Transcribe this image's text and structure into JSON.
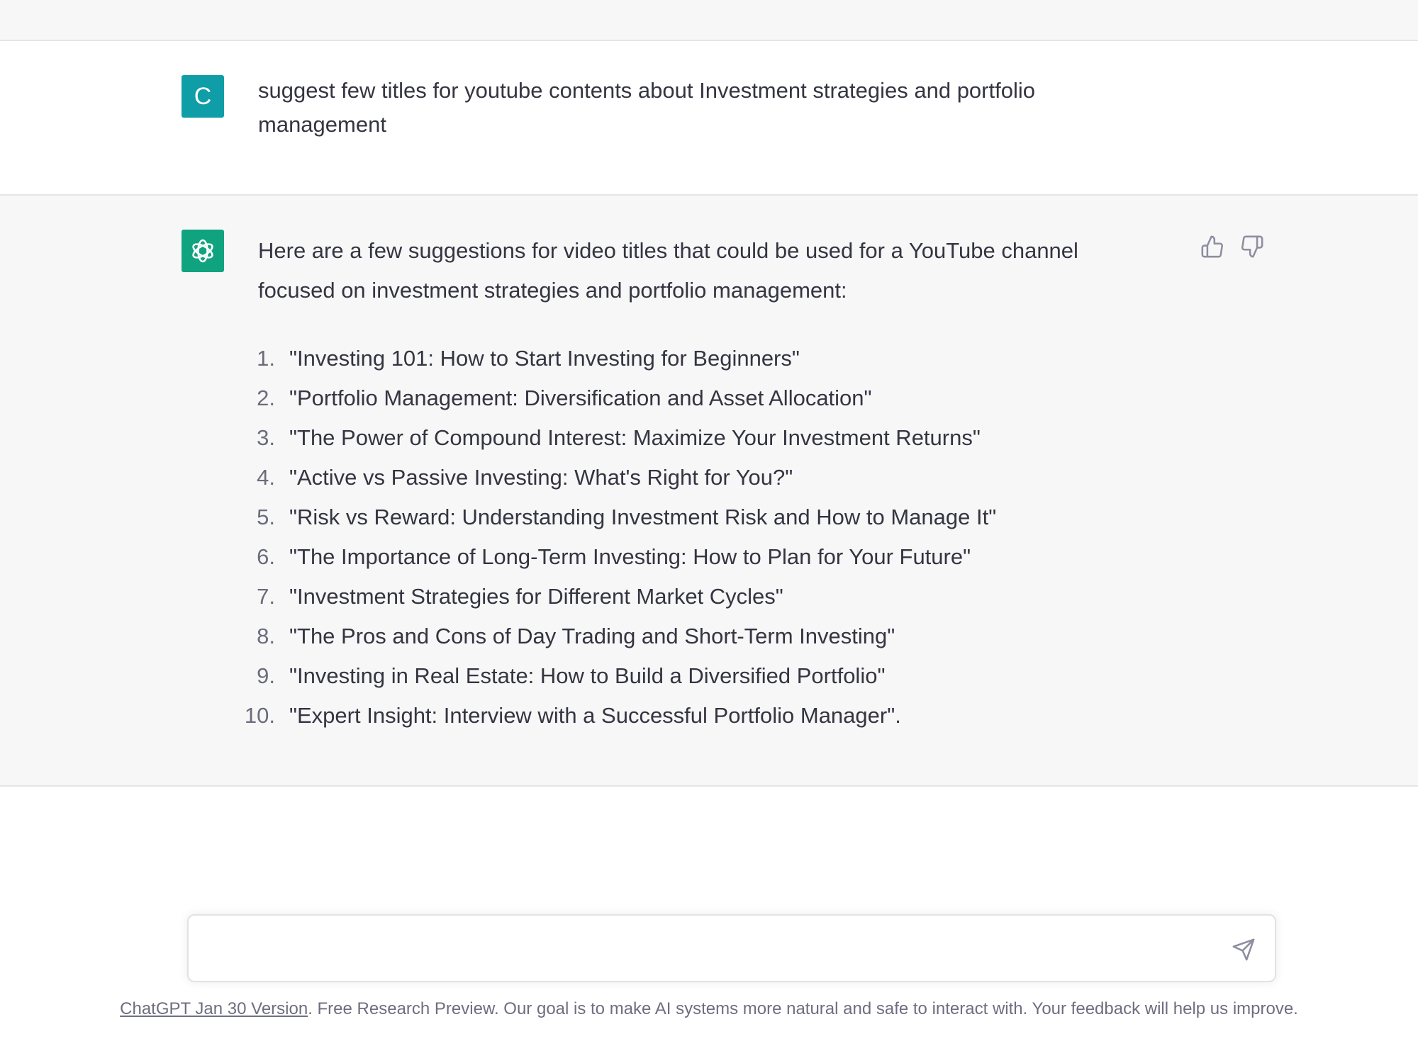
{
  "user_message": {
    "avatar_letter": "C",
    "avatar_color": "#0f9ea8",
    "text": "suggest few titles for youtube contents about Investment strategies and portfolio management"
  },
  "assistant_message": {
    "avatar_icon": "openai-logo-icon",
    "avatar_color": "#10a37f",
    "intro": "Here are a few suggestions for video titles that could be used for a YouTube channel focused on investment strategies and portfolio management:",
    "titles": [
      {
        "num": "1.",
        "text": "\"Investing 101: How to Start Investing for Beginners\""
      },
      {
        "num": "2.",
        "text": "\"Portfolio Management: Diversification and Asset Allocation\""
      },
      {
        "num": "3.",
        "text": "\"The Power of Compound Interest: Maximize Your Investment Returns\""
      },
      {
        "num": "4.",
        "text": "\"Active vs Passive Investing: What's Right for You?\""
      },
      {
        "num": "5.",
        "text": "\"Risk vs Reward: Understanding Investment Risk and How to Manage It\""
      },
      {
        "num": "6.",
        "text": "\"The Importance of Long-Term Investing: How to Plan for Your Future\""
      },
      {
        "num": "7.",
        "text": "\"Investment Strategies for Different Market Cycles\""
      },
      {
        "num": "8.",
        "text": "\"The Pros and Cons of Day Trading and Short-Term Investing\""
      },
      {
        "num": "9.",
        "text": "\"Investing in Real Estate: How to Build a Diversified Portfolio\""
      },
      {
        "num": "10.",
        "text": "\"Expert Insight: Interview with a Successful Portfolio Manager\"."
      }
    ]
  },
  "feedback": {
    "thumbs_up_icon": "thumbs-up-icon",
    "thumbs_down_icon": "thumbs-down-icon"
  },
  "composer": {
    "value": "",
    "placeholder": "",
    "send_icon": "send-icon"
  },
  "footer": {
    "link_text": "ChatGPT Jan 30 Version",
    "text": ". Free Research Preview. Our goal is to make AI systems more natural and safe to interact with. Your feedback will help us improve."
  }
}
